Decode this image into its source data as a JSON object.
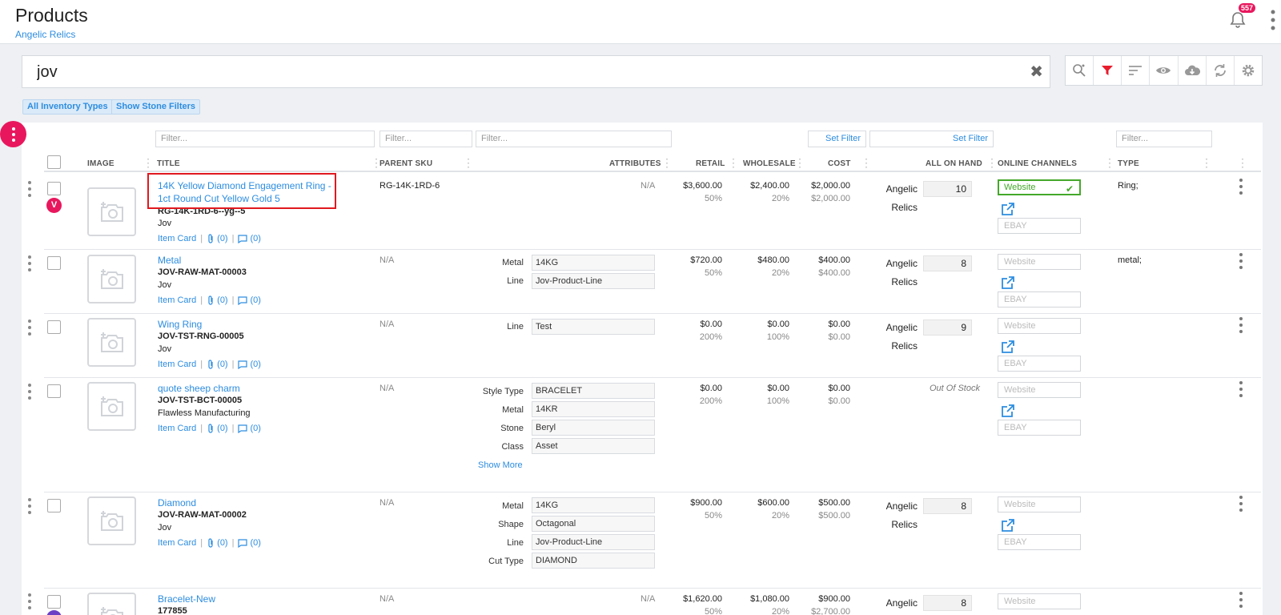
{
  "header": {
    "title": "Products",
    "subtitle": "Angelic Relics",
    "notification_count": "557"
  },
  "search": {
    "value": "jov",
    "clear_icon": "close-icon"
  },
  "toolbar": {
    "icons": [
      "search-settings-icon",
      "filter-icon",
      "sort-icon",
      "eye-icon",
      "cloud-download-icon",
      "sync-icon",
      "gear-icon"
    ],
    "accent": "#e8175d"
  },
  "chips": {
    "inventory": "All Inventory Types",
    "stone": "Show Stone Filters"
  },
  "filters": {
    "placeholder": "Filter...",
    "set_filter": "Set Filter"
  },
  "columns": {
    "image": "IMAGE",
    "title": "TITLE",
    "parent_sku": "PARENT SKU",
    "attributes": "ATTRIBUTES",
    "retail": "RETAIL",
    "wholesale": "WHOLESALE",
    "cost": "COST",
    "on_hand": "ALL ON HAND",
    "channels": "ONLINE CHANNELS",
    "type": "TYPE"
  },
  "common": {
    "item_card": "Item Card",
    "attach_count": "(0)",
    "comment_count": "(0)",
    "website": "Website",
    "ebay": "EBAY",
    "loc_line1": "Angelic",
    "loc_line2": "Relics",
    "out_of_stock": "Out Of Stock",
    "show_more": "Show More",
    "na": "N/A"
  },
  "rows": [
    {
      "title": "14K Yellow Diamond Engagement Ring - 1ct Round Cut Yellow Gold 5",
      "sku": "RG-14K-1RD-6--yg--5",
      "vendor": "Jov",
      "parent_sku": "RG-14K-1RD-6",
      "attributes_na": "N/A",
      "retail": "$3,600.00",
      "retail_pct": "50%",
      "wholesale": "$2,400.00",
      "wholesale_pct": "20%",
      "cost": "$2,000.00",
      "cost_sub": "$2,000.00",
      "qty": "10",
      "type": "Ring;",
      "badge": "V"
    },
    {
      "title": "Metal",
      "sku": "JOV-RAW-MAT-00003",
      "vendor": "Jov",
      "parent_sku": "N/A",
      "attributes": [
        {
          "label": "Metal",
          "value": "14KG"
        },
        {
          "label": "Line",
          "value": "Jov-Product-Line"
        }
      ],
      "retail": "$720.00",
      "retail_pct": "50%",
      "wholesale": "$480.00",
      "wholesale_pct": "20%",
      "cost": "$400.00",
      "cost_sub": "$400.00",
      "qty": "8",
      "type": "metal;"
    },
    {
      "title": "Wing Ring",
      "sku": "JOV-TST-RNG-00005",
      "vendor": "Jov",
      "parent_sku": "N/A",
      "attributes": [
        {
          "label": "Line",
          "value": "Test"
        }
      ],
      "retail": "$0.00",
      "retail_pct": "200%",
      "wholesale": "$0.00",
      "wholesale_pct": "100%",
      "cost": "$0.00",
      "cost_sub": "$0.00",
      "qty": "9",
      "type": ""
    },
    {
      "title": "quote sheep charm",
      "sku": "JOV-TST-BCT-00005",
      "vendor": "Flawless Manufacturing",
      "parent_sku": "N/A",
      "attributes": [
        {
          "label": "Style Type",
          "value": "BRACELET"
        },
        {
          "label": "Metal",
          "value": "14KR"
        },
        {
          "label": "Stone",
          "value": "Beryl"
        },
        {
          "label": "Class",
          "value": "Asset"
        }
      ],
      "retail": "$0.00",
      "retail_pct": "200%",
      "wholesale": "$0.00",
      "wholesale_pct": "100%",
      "cost": "$0.00",
      "cost_sub": "$0.00",
      "type": ""
    },
    {
      "title": "Diamond",
      "sku": "JOV-RAW-MAT-00002",
      "vendor": "Jov",
      "parent_sku": "N/A",
      "attributes": [
        {
          "label": "Metal",
          "value": "14KG"
        },
        {
          "label": "Shape",
          "value": "Octagonal"
        },
        {
          "label": "Line",
          "value": "Jov-Product-Line"
        },
        {
          "label": "Cut Type",
          "value": "DIAMOND"
        }
      ],
      "retail": "$900.00",
      "retail_pct": "50%",
      "wholesale": "$600.00",
      "wholesale_pct": "20%",
      "cost": "$500.00",
      "cost_sub": "$500.00",
      "qty": "8",
      "type": ""
    },
    {
      "title": "Bracelet-New",
      "sku": "177855",
      "parent_sku": "N/A",
      "attributes_na": "N/A",
      "retail": "$1,620.00",
      "retail_pct": "50%",
      "wholesale": "$1,080.00",
      "wholesale_pct": "20%",
      "cost": "$900.00",
      "cost_sub": "$2,700.00",
      "qty": "8",
      "type": ""
    }
  ]
}
